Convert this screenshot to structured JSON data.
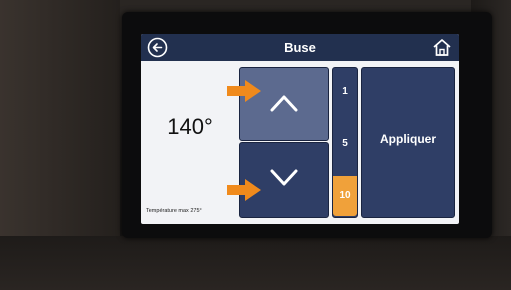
{
  "header": {
    "title": "Buse"
  },
  "temperature": {
    "value": "140°",
    "max_label": "Température max 275°"
  },
  "step_selector": {
    "options": [
      "1",
      "5",
      "10"
    ],
    "selected": "10"
  },
  "apply_button": {
    "label": "Appliquer"
  },
  "icons": {
    "back": "back-arrow-icon",
    "home": "home-icon",
    "up": "chevron-up-icon",
    "down": "chevron-down-icon"
  },
  "colors": {
    "header_bg": "#22304f",
    "button_bg": "#2f3e66",
    "accent": "#f0a13a",
    "annotation_arrow": "#f08a1c"
  }
}
